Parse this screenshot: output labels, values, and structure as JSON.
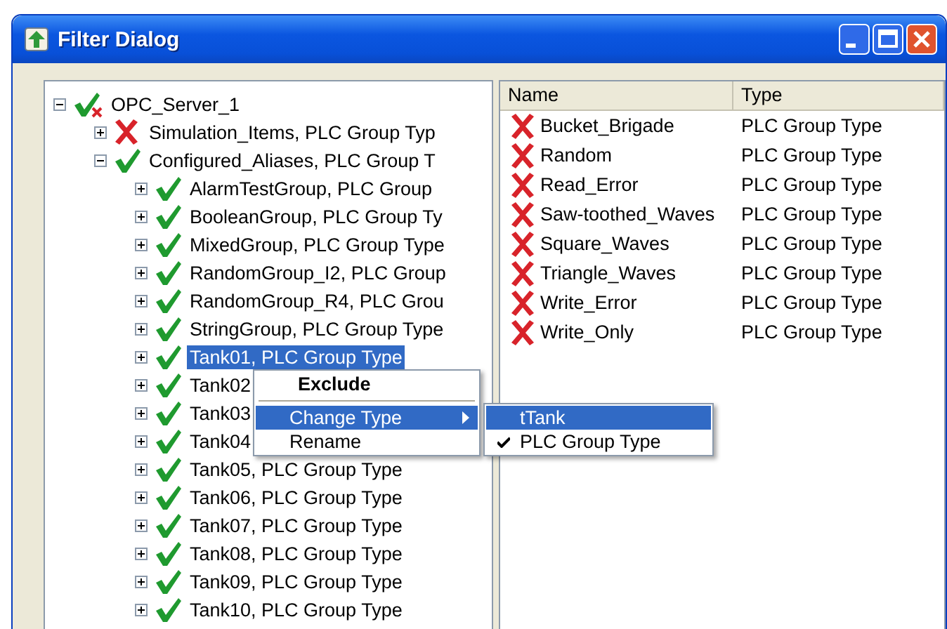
{
  "window": {
    "title": "Filter Dialog",
    "controls": [
      {
        "kind": "minimize"
      },
      {
        "kind": "maximize"
      },
      {
        "kind": "close"
      }
    ]
  },
  "tree": [
    {
      "label": "OPC_Server_1",
      "kind": "partial",
      "expanded": true,
      "selected": false,
      "children": [
        {
          "label": "Simulation_Items, PLC Group Typ",
          "kind": "error",
          "expanded": false,
          "selected": false
        },
        {
          "label": "Configured_Aliases, PLC Group T",
          "kind": "ok",
          "expanded": true,
          "selected": false,
          "children": [
            {
              "label": "AlarmTestGroup, PLC Group",
              "kind": "ok",
              "expanded": false,
              "selected": false
            },
            {
              "label": "BooleanGroup, PLC Group Ty",
              "kind": "ok",
              "expanded": false,
              "selected": false
            },
            {
              "label": "MixedGroup, PLC Group Type",
              "kind": "ok",
              "expanded": false,
              "selected": false
            },
            {
              "label": "RandomGroup_I2, PLC Group",
              "kind": "ok",
              "expanded": false,
              "selected": false
            },
            {
              "label": "RandomGroup_R4, PLC Grou",
              "kind": "ok",
              "expanded": false,
              "selected": false
            },
            {
              "label": "StringGroup, PLC Group Type",
              "kind": "ok",
              "expanded": false,
              "selected": false
            },
            {
              "label": "Tank01, PLC Group Type",
              "kind": "ok",
              "expanded": false,
              "selected": true
            },
            {
              "label": "Tank02",
              "kind": "ok",
              "expanded": false,
              "selected": false
            },
            {
              "label": "Tank03",
              "kind": "ok",
              "expanded": false,
              "selected": false
            },
            {
              "label": "Tank04",
              "kind": "ok",
              "expanded": false,
              "selected": false
            },
            {
              "label": "Tank05, PLC Group Type",
              "kind": "ok",
              "expanded": false,
              "selected": false
            },
            {
              "label": "Tank06, PLC Group Type",
              "kind": "ok",
              "expanded": false,
              "selected": false
            },
            {
              "label": "Tank07, PLC Group Type",
              "kind": "ok",
              "expanded": false,
              "selected": false
            },
            {
              "label": "Tank08, PLC Group Type",
              "kind": "ok",
              "expanded": false,
              "selected": false
            },
            {
              "label": "Tank09, PLC Group Type",
              "kind": "ok",
              "expanded": false,
              "selected": false
            },
            {
              "label": "Tank10, PLC Group Type",
              "kind": "ok",
              "expanded": false,
              "selected": false
            }
          ]
        }
      ]
    }
  ],
  "list": {
    "columns": [
      "Name",
      "Type"
    ],
    "rows": [
      {
        "name": "Bucket_Brigade",
        "type": "PLC Group Type",
        "kind": "error"
      },
      {
        "name": "Random",
        "type": "PLC Group Type",
        "kind": "error"
      },
      {
        "name": "Read_Error",
        "type": "PLC Group Type",
        "kind": "error"
      },
      {
        "name": "Saw-toothed_Waves",
        "type": "PLC Group Type",
        "kind": "error"
      },
      {
        "name": "Square_Waves",
        "type": "PLC Group Type",
        "kind": "error"
      },
      {
        "name": "Triangle_Waves",
        "type": "PLC Group Type",
        "kind": "error"
      },
      {
        "name": "Write_Error",
        "type": "PLC Group Type",
        "kind": "error"
      },
      {
        "name": "Write_Only",
        "type": "PLC Group Type",
        "kind": "error"
      }
    ]
  },
  "context_menu": {
    "items": [
      {
        "kind": "default",
        "label": "Exclude",
        "selected": false
      },
      {
        "kind": "separator"
      },
      {
        "kind": "submenu",
        "label": "Change Type",
        "selected": true
      },
      {
        "kind": "item",
        "label": "Rename",
        "selected": false
      }
    ]
  },
  "submenu": {
    "items": [
      {
        "label": "tTank",
        "selected": true,
        "checked": false
      },
      {
        "label": "PLC Group Type",
        "selected": false,
        "checked": true
      }
    ]
  }
}
